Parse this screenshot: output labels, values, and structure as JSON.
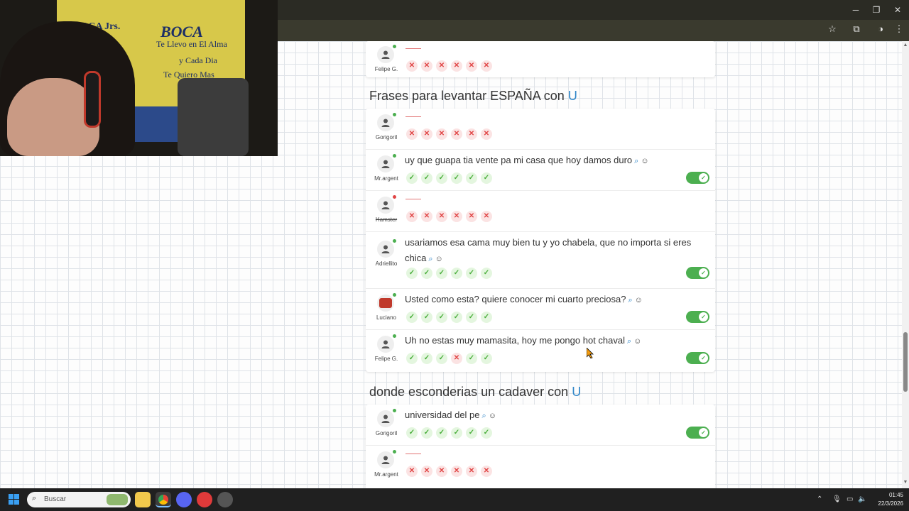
{
  "browser": {
    "window_controls": {
      "minimize": "─",
      "restore": "❐",
      "close": "✕"
    },
    "toolbar_icons": [
      "star-icon",
      "extensions-icon",
      "profile-icon",
      "menu-icon"
    ]
  },
  "webcam": {
    "banner_line1": "BOCA Jrs.",
    "banner_line2": "BOCA",
    "banner_line3": "Te Llevo en El Alma",
    "banner_line4": "y Cada Dia",
    "banner_line5": "Te Quiero Mas"
  },
  "top_card": {
    "rows": [
      {
        "user": "Felipe G.",
        "online": true,
        "answer": "",
        "marks": [
          "no",
          "no",
          "no",
          "no",
          "no",
          "no"
        ],
        "toggle": false
      }
    ]
  },
  "sections": [
    {
      "title_prefix": "Frases para levantar ESPAÑA con",
      "letter": "U",
      "rows": [
        {
          "user": "Gorigoril",
          "online": true,
          "answer": "",
          "marks": [
            "no",
            "no",
            "no",
            "no",
            "no",
            "no"
          ],
          "toggle": false
        },
        {
          "user": "Mr.argent",
          "online": true,
          "answer": "uy que guapa tia vente pa mi casa que hoy damos duro",
          "marks": [
            "ok",
            "ok",
            "ok",
            "ok",
            "ok",
            "ok"
          ],
          "toggle": true
        },
        {
          "user": "Hamster",
          "online": false,
          "answer": "",
          "marks": [
            "no",
            "no",
            "no",
            "no",
            "no",
            "no"
          ],
          "toggle": false,
          "strike": true
        },
        {
          "user": "Adriellito",
          "online": true,
          "answer": "usariamos esa cama muy bien tu y yo chabela, que no importa si eres chica",
          "marks": [
            "ok",
            "ok",
            "ok",
            "ok",
            "ok",
            "ok"
          ],
          "toggle": true
        },
        {
          "user": "Luciano",
          "online": true,
          "answer": "Usted como esta? quiere conocer mi cuarto preciosa?",
          "marks": [
            "ok",
            "ok",
            "ok",
            "ok",
            "ok",
            "ok"
          ],
          "toggle": true,
          "avatar_badge": true
        },
        {
          "user": "Felipe G.",
          "online": true,
          "answer": "Uh no estas muy mamasita, hoy me pongo hot chaval",
          "marks": [
            "ok",
            "ok",
            "ok",
            "no",
            "ok",
            "ok"
          ],
          "toggle": true
        }
      ]
    },
    {
      "title_prefix": "donde esconderias un cadaver con",
      "letter": "U",
      "rows": [
        {
          "user": "Gorigoril",
          "online": true,
          "answer": "universidad del pe",
          "marks": [
            "ok",
            "ok",
            "ok",
            "ok",
            "ok",
            "ok"
          ],
          "toggle": true
        },
        {
          "user": "Mr.argent",
          "online": true,
          "answer": "",
          "marks": [
            "no",
            "no",
            "no",
            "no",
            "no",
            "no"
          ],
          "toggle": false
        }
      ]
    }
  ],
  "colors": {
    "accent_blue": "#2f86c8",
    "ok_green": "#4caf3d",
    "no_red": "#e04545",
    "toggle_green": "#4caf50",
    "online_green": "#4caf50",
    "offline_red": "#e04545"
  },
  "taskbar": {
    "search_placeholder": "Buscar",
    "time": "01:45",
    "date": "22/3/2026"
  }
}
